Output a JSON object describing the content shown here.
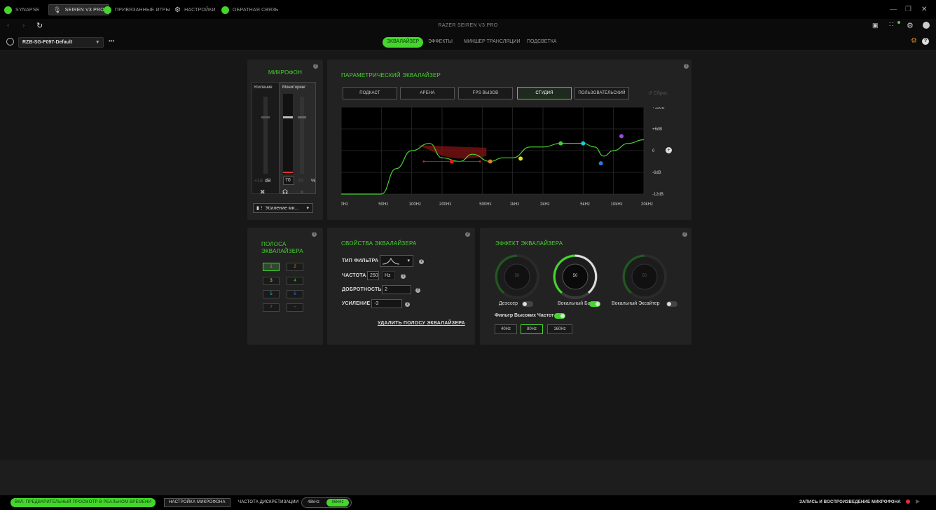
{
  "tabs": [
    {
      "label": "SYNAPSE",
      "icon": "razer-logo-icon",
      "active": false
    },
    {
      "label": "SEIREN V3 PRO",
      "icon": "microphone-icon",
      "active": true
    },
    {
      "label": "ПРИВЯЗАННЫЕ ИГРЫ",
      "icon": "gamepad-icon",
      "active": false
    },
    {
      "label": "НАСТРОЙКИ",
      "icon": "gear-icon",
      "active": false
    },
    {
      "label": "ОБРАТНАЯ СВЯЗЬ",
      "icon": "feedback-icon",
      "active": false
    }
  ],
  "window": {
    "title": "RAZER SEIREN V3 PRO"
  },
  "profile": {
    "name": "RZB-SG-F097-Default",
    "more": "•••"
  },
  "subtabs": [
    {
      "label": "ЭКВАЛАЙЗЕР",
      "active": true
    },
    {
      "label": "ЭФФЕКТЫ",
      "active": false
    },
    {
      "label": "МИКШЕР ТРАНСЛЯЦИИ",
      "active": false
    },
    {
      "label": "ПОДСВЕТКА",
      "active": false
    }
  ],
  "mic": {
    "title": "МИКРОФОН",
    "gain_label": "Усиление",
    "monitor_label": "Мониторинг",
    "gain_value": "+19",
    "gain_unit": "dB",
    "monitor_value": "70",
    "mix_value": "70",
    "mix_unit": "%",
    "dropdown": "Усиление ми..."
  },
  "eq": {
    "title": "ПАРАМЕТРИЧЕСКИЙ ЭКВАЛАЙЗЕР",
    "presets": [
      "ПОДКАСТ",
      "АРЕНА",
      "FPS ВЫЗОВ",
      "СТУДИЯ",
      "ПОЛЬЗОВАТЕЛЬСКИЙ"
    ],
    "active_preset": "СТУДИЯ",
    "reset": "Сброс",
    "gain_ticks": [
      "+12dB",
      "+6dB",
      "0",
      "-6dB",
      "-12dB"
    ],
    "freq_ticks": [
      "20Hz",
      "50Hz",
      "100Hz",
      "200Hz",
      "500Hz",
      "1kHz",
      "2kHz",
      "5kHz",
      "10kHz",
      "20kHz"
    ]
  },
  "chart_data": {
    "type": "line",
    "x_scale": "log",
    "xlim": [
      20,
      20000
    ],
    "ylim": [
      -12,
      12
    ],
    "x_ticks": [
      20,
      50,
      100,
      200,
      500,
      1000,
      2000,
      5000,
      10000,
      20000
    ],
    "y_ticks": [
      12,
      6,
      0,
      -6,
      -12
    ],
    "curve": {
      "x": [
        20,
        50,
        70,
        100,
        150,
        200,
        300,
        400,
        600,
        800,
        1000,
        1500,
        2000,
        3000,
        4000,
        5000,
        6500,
        8000,
        10000,
        14000,
        20000
      ],
      "y": [
        -12,
        -12,
        -5,
        0,
        2,
        -2,
        -3,
        -1,
        -3,
        -2,
        -2,
        1,
        1,
        2,
        2,
        2,
        1,
        -1.5,
        0,
        2,
        3
      ]
    },
    "bands": [
      {
        "band": 1,
        "freq": 250,
        "gain": -3,
        "color": "#e02020"
      },
      {
        "band": 2,
        "freq": 600,
        "gain": -3,
        "color": "#e57a2a"
      },
      {
        "band": 3,
        "freq": 1200,
        "gain": -2.2,
        "color": "#e6e12b"
      },
      {
        "band": 4,
        "freq": 3000,
        "gain": 2,
        "color": "#3ed13e"
      },
      {
        "band": 5,
        "freq": 5000,
        "gain": 2,
        "color": "#27c7d6"
      },
      {
        "band": 6,
        "freq": 7500,
        "gain": -3.5,
        "color": "#2a7be0"
      },
      {
        "band": 7,
        "freq": 12000,
        "gain": 4,
        "color": "#9b4be0"
      }
    ]
  },
  "bands_panel": {
    "title_line1": "ПОЛОСА",
    "title_line2": "ЭКВАЛАЙЗЕРА",
    "items": [
      "1",
      "2",
      "3",
      "4",
      "5",
      "6",
      "7",
      "+"
    ],
    "selected": "1"
  },
  "props": {
    "title": "СВОЙСТВА ЭКВАЛАЙЗЕРА",
    "filter_label": "ТИП ФИЛЬТРА",
    "freq_label": "ЧАСТОТА",
    "freq_value": "250",
    "freq_unit": "Hz",
    "q_label": "ДОБРОТНОСТЬ",
    "q_value": "2",
    "gain_label": "УСИЛЕНИЕ",
    "gain_value": "-3",
    "delete": "УДАЛИТЬ ПОЛОСУ ЭКВАЛАЙЗЕРА"
  },
  "effects": {
    "title": "ЭФФЕКТ ЭКВАЛАЙЗЕРА",
    "knobs": [
      {
        "label": "Деэссер",
        "value": "50",
        "on": false
      },
      {
        "label": "Вокальный Бас",
        "value": "50",
        "on": true
      },
      {
        "label": "Вокальный Эксайтер",
        "value": "50",
        "on": false
      }
    ],
    "hp_label": "Фильтр Высоких Частот",
    "hp_on": true,
    "hp_options": [
      "40Hz",
      "80Hz",
      "160Hz"
    ],
    "hp_selected": "80Hz"
  },
  "bottom": {
    "preview": "ВКЛ. ПРЕДВАРИТЕЛЬНЫЙ ПРОСМОТР В РЕАЛЬНОМ ВРЕМЕНИ",
    "mic_setup": "НАСТРОЙКА МИКРОФОНА",
    "rate_label": "ЧАСТОТА ДИСКРЕТИЗАЦИИ",
    "rates": [
      "48kHz",
      "96kHz"
    ],
    "rate_selected": "96kHz",
    "record": "ЗАПИСЬ И ВОСПРОИЗВЕДЕНИЕ МИКРОФОНА"
  },
  "colors": {
    "accent": "#44d62c",
    "panel": "#222222",
    "background": "#171717"
  }
}
